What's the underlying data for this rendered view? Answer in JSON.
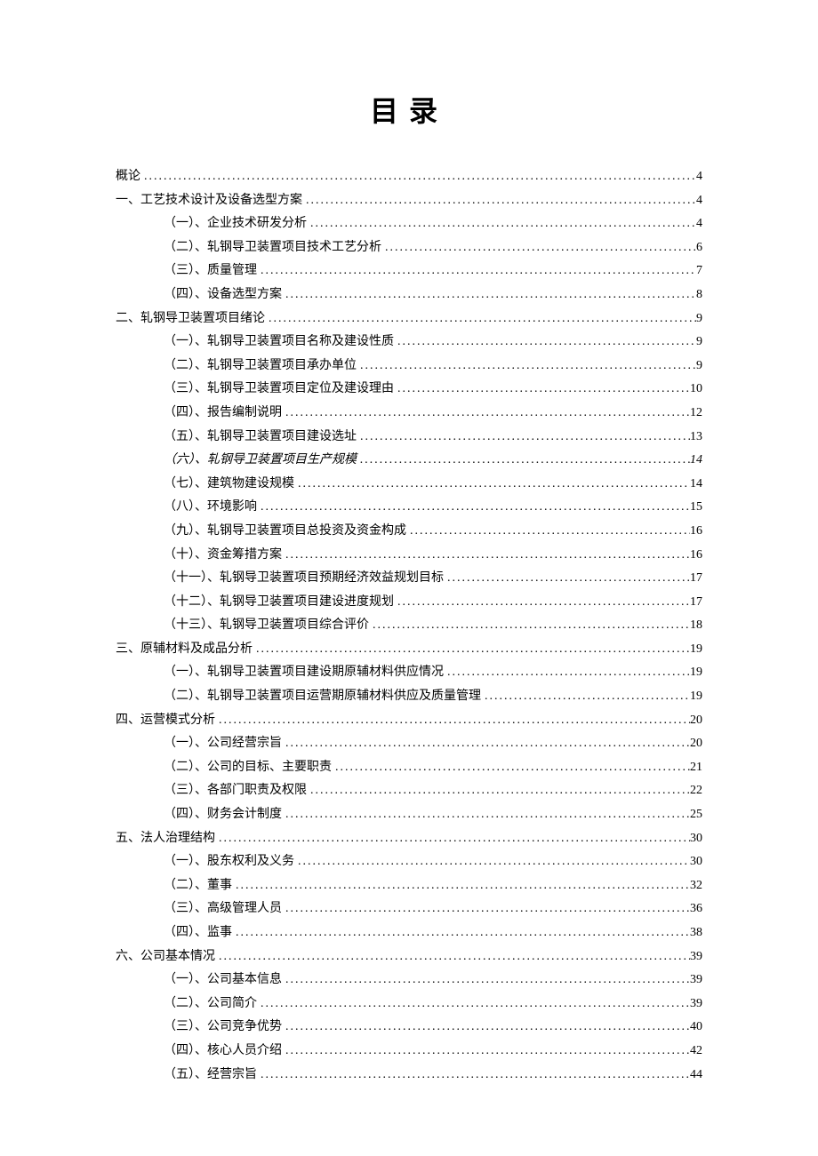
{
  "title": "目录",
  "entries": [
    {
      "level": 1,
      "label": "概论",
      "page": "4"
    },
    {
      "level": 1,
      "label": "一、工艺技术设计及设备选型方案",
      "page": "4"
    },
    {
      "level": 2,
      "label": "（一）、企业技术研发分析",
      "page": "4"
    },
    {
      "level": 2,
      "label": "（二）、轧钢导卫装置项目技术工艺分析",
      "page": "6"
    },
    {
      "level": 2,
      "label": "（三）、质量管理",
      "page": "7"
    },
    {
      "level": 2,
      "label": "（四）、设备选型方案",
      "page": "8"
    },
    {
      "level": 1,
      "label": "二、轧钢导卫装置项目绪论",
      "page": "9"
    },
    {
      "level": 2,
      "label": "（一）、轧钢导卫装置项目名称及建设性质",
      "page": "9"
    },
    {
      "level": 2,
      "label": "（二）、轧钢导卫装置项目承办单位",
      "page": "9"
    },
    {
      "level": 2,
      "label": "（三）、轧钢导卫装置项目定位及建设理由",
      "page": "10"
    },
    {
      "level": 2,
      "label": "（四）、报告编制说明",
      "page": "12"
    },
    {
      "level": 2,
      "label": "（五）、轧钢导卫装置项目建设选址",
      "page": "13"
    },
    {
      "level": 2,
      "label": "（六）、轧钢导卫装置项目生产规模",
      "page": "14",
      "italic": true
    },
    {
      "level": 2,
      "label": "（七）、建筑物建设规模",
      "page": "14"
    },
    {
      "level": 2,
      "label": "（八）、环境影响",
      "page": "15"
    },
    {
      "level": 2,
      "label": "（九）、轧钢导卫装置项目总投资及资金构成",
      "page": "16"
    },
    {
      "level": 2,
      "label": "（十）、资金筹措方案",
      "page": "16"
    },
    {
      "level": 2,
      "label": "（十一）、轧钢导卫装置项目预期经济效益规划目标",
      "page": "17"
    },
    {
      "level": 2,
      "label": "（十二）、轧钢导卫装置项目建设进度规划",
      "page": "17"
    },
    {
      "level": 2,
      "label": "（十三）、轧钢导卫装置项目综合评价",
      "page": "18"
    },
    {
      "level": 1,
      "label": "三、原辅材料及成品分析",
      "page": "19"
    },
    {
      "level": 2,
      "label": "（一）、轧钢导卫装置项目建设期原辅材料供应情况",
      "page": "19"
    },
    {
      "level": 2,
      "label": "（二）、轧钢导卫装置项目运营期原辅材料供应及质量管理",
      "page": "19"
    },
    {
      "level": 1,
      "label": "四、运营模式分析",
      "page": "20"
    },
    {
      "level": 2,
      "label": "（一）、公司经营宗旨",
      "page": "20"
    },
    {
      "level": 2,
      "label": "（二）、公司的目标、主要职责",
      "page": "21"
    },
    {
      "level": 2,
      "label": "（三）、各部门职责及权限",
      "page": "22"
    },
    {
      "level": 2,
      "label": "（四）、财务会计制度",
      "page": "25"
    },
    {
      "level": 1,
      "label": "五、法人治理结构",
      "page": "30"
    },
    {
      "level": 2,
      "label": "（一）、股东权利及义务",
      "page": "30"
    },
    {
      "level": 2,
      "label": "（二）、董事",
      "page": "32"
    },
    {
      "level": 2,
      "label": "（三）、高级管理人员",
      "page": "36"
    },
    {
      "level": 2,
      "label": "（四）、监事",
      "page": "38"
    },
    {
      "level": 1,
      "label": "六、公司基本情况",
      "page": "39"
    },
    {
      "level": 2,
      "label": "（一）、公司基本信息",
      "page": "39"
    },
    {
      "level": 2,
      "label": "（二）、公司简介",
      "page": "39"
    },
    {
      "level": 2,
      "label": "（三）、公司竞争优势",
      "page": "40"
    },
    {
      "level": 2,
      "label": "（四）、核心人员介绍",
      "page": "42"
    },
    {
      "level": 2,
      "label": "（五）、经营宗旨",
      "page": "44"
    }
  ]
}
